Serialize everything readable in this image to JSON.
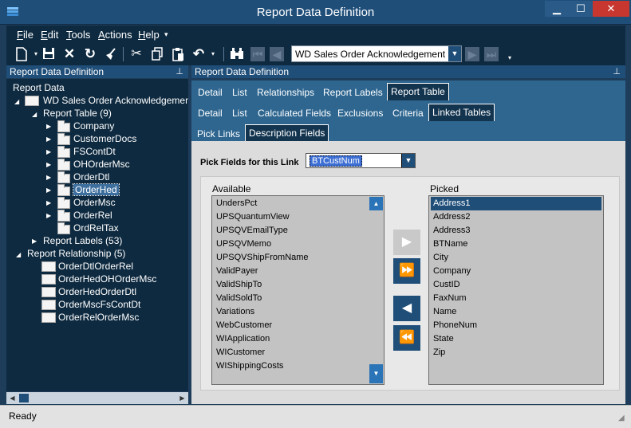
{
  "window": {
    "title": "Report Data Definition",
    "min": "▁",
    "max": "☐",
    "close": "✕"
  },
  "menubar": {
    "items": [
      {
        "key": "F",
        "rest": "ile"
      },
      {
        "key": "E",
        "rest": "dit"
      },
      {
        "key": "T",
        "rest": "ools"
      },
      {
        "key": "A",
        "rest": "ctions"
      },
      {
        "key": "H",
        "rest": "elp"
      }
    ],
    "overflow": "▾"
  },
  "toolbar": {
    "icons": [
      "new-document-icon",
      "save-icon",
      "delete-icon",
      "refresh-icon",
      "clear-icon",
      "cut-icon",
      "copy-icon",
      "paste-icon",
      "undo-icon",
      "binoculars-icon",
      "first-icon",
      "previous-icon",
      "next-icon",
      "last-icon"
    ],
    "document_combo": "WD Sales Order Acknowledgement",
    "overflow": "▾"
  },
  "left_panel": {
    "header": "Report Data Definition",
    "tree": {
      "root": "Report Data",
      "report": "WD Sales Order Acknowledgement",
      "report_table": "Report Table (9)",
      "tables": [
        "Company",
        "CustomerDocs",
        "FSContDt",
        "OHOrderMsc",
        "OrderDtl",
        "OrderHed",
        "OrderMsc",
        "OrderRel",
        "OrdRelTax"
      ],
      "selected_table": "OrderHed",
      "report_labels": "Report Labels (53)",
      "report_relationship": "Report Relationship (5)",
      "relationships": [
        "OrderDtlOrderRel",
        "OrderHedOHOrderMsc",
        "OrderHedOrderDtl",
        "OrderMscFsContDt",
        "OrderRelOrderMsc"
      ]
    }
  },
  "right_panel": {
    "header": "Report Data Definition",
    "tabs_level1": [
      "Detail",
      "List",
      "Relationships",
      "Report Labels",
      "Report Table"
    ],
    "tabs_level2": [
      "Detail",
      "List",
      "Calculated Fields",
      "Exclusions",
      "Criteria",
      "Linked Tables"
    ],
    "tabs_level3": [
      "Pick Links",
      "Description Fields"
    ],
    "pick_fields_label": "Pick Fields for this Link",
    "pick_fields_value": "BTCustNum",
    "available_label": "Available",
    "available": [
      "UndersPct",
      "UPSQuantumView",
      "UPSQVEmailType",
      "UPSQVMemo",
      "UPSQVShipFromName",
      "ValidPayer",
      "ValidShipTo",
      "ValidSoldTo",
      "Variations",
      "WebCustomer",
      "WIApplication",
      "WICustomer",
      "WIShippingCosts"
    ],
    "picked_label": "Picked",
    "picked": [
      "Address1",
      "Address2",
      "Address3",
      "BTName",
      "City",
      "Company",
      "CustID",
      "FaxNum",
      "Name",
      "PhoneNum",
      "State",
      "Zip"
    ]
  },
  "status": {
    "text": "Ready"
  }
}
